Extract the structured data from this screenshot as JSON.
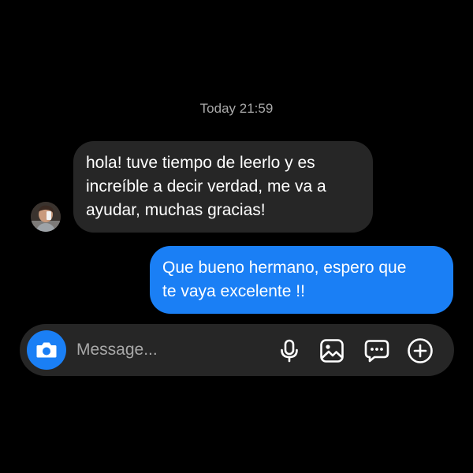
{
  "conversation": {
    "timestamp": "Today 21:59",
    "messages": [
      {
        "direction": "received",
        "lines": [
          "hola! tuve tiempo de leerlo y es",
          "increíble a decir verdad, me va a",
          "ayudar, muchas gracias!"
        ]
      },
      {
        "direction": "sent",
        "lines": [
          "Que bueno hermano, espero que",
          "te vaya excelente !!"
        ]
      }
    ]
  },
  "composer": {
    "placeholder": "Message...",
    "value": "",
    "icons": [
      "camera-icon",
      "microphone-icon",
      "gallery-icon",
      "sticker-icon",
      "plus-icon"
    ]
  },
  "colors": {
    "background": "#000000",
    "received_bubble": "#262626",
    "sent_bubble": "#1a7ff5",
    "timestamp_text": "#a8a8a8",
    "message_text": "#ffffff"
  }
}
